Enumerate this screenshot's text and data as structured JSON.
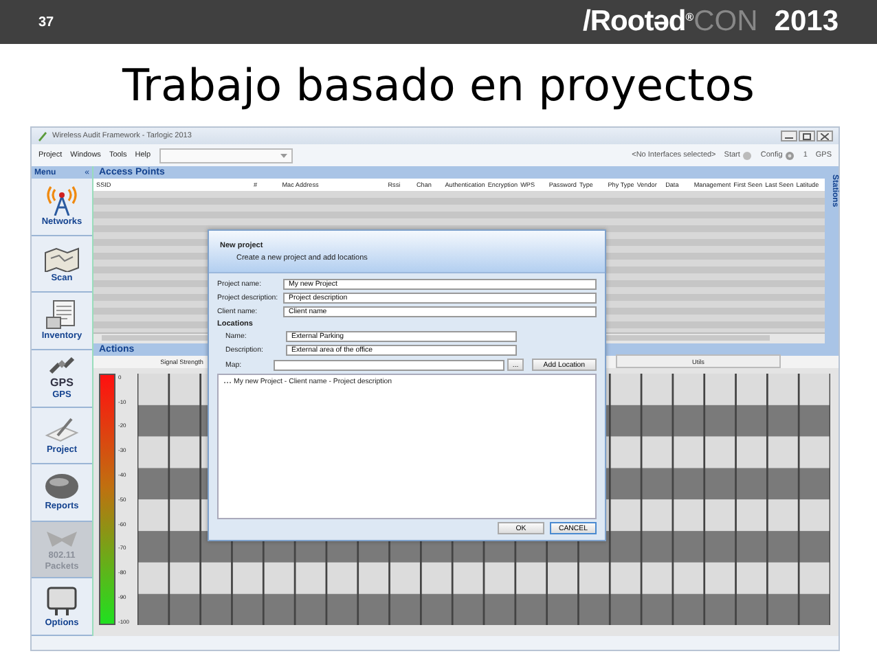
{
  "slide": {
    "number": "37",
    "logo": {
      "brand": "/Rootəd",
      "mark": "®",
      "con": "CON",
      "year": "2013"
    },
    "title": "Trabajo basado en proyectos"
  },
  "window": {
    "title": "Wireless Audit Framework - Tarlogic 2013"
  },
  "menu_bar": {
    "items": [
      "Project",
      "Windows",
      "Tools",
      "Help"
    ],
    "interface_status": "<No Interfaces selected>",
    "start": "Start",
    "config": "Config",
    "count": "1",
    "gps": "GPS"
  },
  "sidebar": {
    "title": "Menu",
    "collapse": "«",
    "items": [
      {
        "kind": "networks",
        "label": "Networks",
        "disabled": false
      },
      {
        "kind": "scan",
        "label": "Scan",
        "disabled": false
      },
      {
        "kind": "inventory",
        "label": "Inventory",
        "disabled": false
      },
      {
        "kind": "gps",
        "icon_text": "GPS",
        "label": "GPS",
        "disabled": false
      },
      {
        "kind": "project",
        "label": "Project",
        "disabled": false
      },
      {
        "kind": "reports",
        "label": "Reports",
        "disabled": false
      },
      {
        "kind": "packets",
        "label": "802.11 Packets",
        "disabled": true
      },
      {
        "kind": "options",
        "label": "Options",
        "disabled": false
      }
    ]
  },
  "access_points": {
    "title": "Access Points",
    "columns": [
      "SSID",
      "#",
      "Mac Address",
      "Rssi",
      "Chan",
      "Authentication",
      "Encryption",
      "WPS",
      "Password",
      "Type",
      "Phy Type",
      "Vendor",
      "Data",
      "Management",
      "First Seen",
      "Last Seen",
      "Latitude"
    ],
    "side_tab": "Stations"
  },
  "actions": {
    "title": "Actions",
    "columns": [
      "Signal Strength",
      "Utils"
    ],
    "scale": [
      "0",
      "-10",
      "-20",
      "-30",
      "-40",
      "-50",
      "-60",
      "-70",
      "-80",
      "-90",
      "-100"
    ]
  },
  "dialog": {
    "title": "New project",
    "subtitle": "Create a new project and add locations",
    "fields": [
      {
        "label": "Project name:",
        "value": "My new Project"
      },
      {
        "label": "Project description:",
        "value": "Project description"
      },
      {
        "label": "Client name:",
        "value": "Client name"
      }
    ],
    "locations_label": "Locations",
    "location_fields": [
      {
        "label": "Name:",
        "value": "External Parking"
      },
      {
        "label": "Description:",
        "value": "External area of the office"
      }
    ],
    "map_label": "Map:",
    "browse": "...",
    "add_location": "Add Location",
    "tree": [
      {
        "label": "My new Project - Client name - Project description"
      }
    ],
    "buttons": {
      "ok": "OK",
      "cancel": "CANCEL"
    }
  }
}
